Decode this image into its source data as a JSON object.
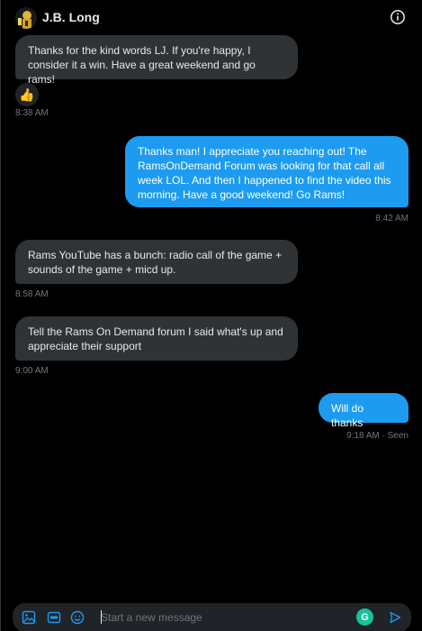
{
  "header": {
    "contact_name": "J.B. Long",
    "info_icon": "info-icon",
    "avatar_icon": "avatar-image"
  },
  "messages": [
    {
      "direction": "in",
      "text": "Thanks for the kind words LJ. If you're happy, I\nconsider it a win. Have a great weekend and go rams!",
      "time": "8:38 AM",
      "reaction": "👍"
    },
    {
      "direction": "out",
      "text": "Thanks man! I appreciate you reaching out! The\nRamsOnDemand Forum was looking for that call all\nweek LOL. And then I happened to find the video this\nmorning.  Have a good weekend! Go Rams!",
      "time": "8:42 AM"
    },
    {
      "direction": "in",
      "text": "Rams YouTube has a bunch: radio call of the game +\nsounds of the game + micd up.",
      "time": "8:58 AM"
    },
    {
      "direction": "in",
      "text": "Tell the Rams On Demand forum I said what's up and\nappreciate their support",
      "time": "9:00 AM"
    },
    {
      "direction": "out",
      "text": "Will do thanks",
      "time": "9:18 AM · Seen"
    }
  ],
  "composer": {
    "placeholder": "Start a new message",
    "icons": [
      "image-icon",
      "gif-icon",
      "emoji-icon",
      "grammarly-icon",
      "send-icon"
    ],
    "grammarly_glyph": "G"
  },
  "colors": {
    "background": "#000000",
    "incoming_bubble": "#2f3336",
    "outgoing_bubble": "#1d9bf0",
    "muted_text": "#71767b",
    "accent": "#1d9bf0"
  }
}
